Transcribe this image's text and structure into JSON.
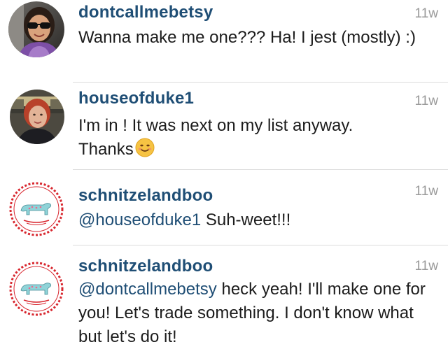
{
  "comments": [
    {
      "username": "dontcallmebetsy",
      "time": "11w",
      "text": "Wanna make me one??? Ha! I jest (mostly) :)",
      "avatar_icon": "profile-photo-woman-sunglasses"
    },
    {
      "username": "houseofduke1",
      "time": "11w",
      "text_line1": "I'm in !  It was next on my list anyway.",
      "text_line2": "Thanks",
      "emoji": "smiling-face-emoji",
      "avatar_icon": "profile-photo-red-hair-woman"
    },
    {
      "username": "schnitzelandboo",
      "time": "11w",
      "mention": "@houseofduke1",
      "text": " Suh-weet!!!",
      "avatar_icon": "schnitzel-and-boo-logo"
    },
    {
      "username": "schnitzelandboo",
      "time": "11w",
      "mention": "@dontcallmebetsy",
      "text": " heck yeah! I'll make one for you! Let's trade something. I don't know what but let's do it!",
      "avatar_icon": "schnitzel-and-boo-logo"
    }
  ],
  "colors": {
    "username": "#1f4e75",
    "text": "#1c1c1c",
    "timestamp": "#9a9a9a",
    "divider": "#dcdcdc",
    "logo_ring": "#d8262e"
  }
}
